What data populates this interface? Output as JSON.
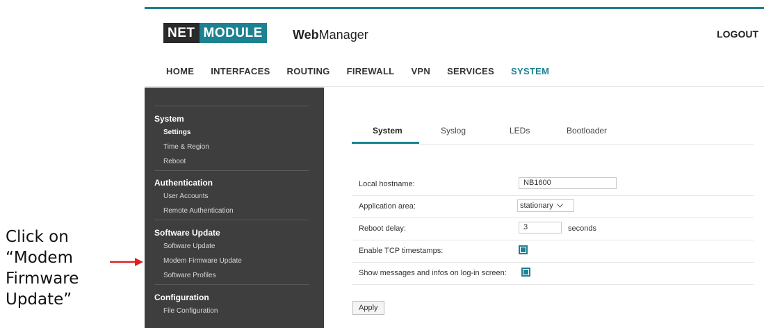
{
  "annotation": {
    "lines": [
      "Click on",
      "“Modem",
      "Firmware",
      "Update”"
    ],
    "arrow_color": "#e02020"
  },
  "header": {
    "logo_net": "NET",
    "logo_module": "MODULE",
    "app_bold": "Web",
    "app_rest": "Manager",
    "logout": "LOGOUT"
  },
  "nav": [
    "HOME",
    "INTERFACES",
    "ROUTING",
    "FIREWALL",
    "VPN",
    "SERVICES",
    "SYSTEM"
  ],
  "nav_active": "SYSTEM",
  "sidebar": {
    "system": {
      "title": "System",
      "items": [
        "Settings",
        "Time & Region",
        "Reboot"
      ]
    },
    "auth": {
      "title": "Authentication",
      "items": [
        "User Accounts",
        "Remote Authentication"
      ]
    },
    "sw": {
      "title": "Software Update",
      "items": [
        "Software Update",
        "Modem Firmware Update",
        "Software Profiles"
      ]
    },
    "config": {
      "title": "Configuration",
      "items": [
        "File Configuration"
      ]
    }
  },
  "tabs": [
    "System",
    "Syslog",
    "LEDs",
    "Bootloader"
  ],
  "form": {
    "hostname_label": "Local hostname:",
    "hostname_value": "NB1600",
    "area_label": "Application area:",
    "area_value": "stationary",
    "reboot_label": "Reboot delay:",
    "reboot_value": "3",
    "reboot_unit": "seconds",
    "tcp_label": "Enable TCP timestamps:",
    "tcp_checked": true,
    "msg_label": "Show messages and infos on log-in screen:",
    "msg_checked": true
  },
  "apply_label": "Apply",
  "colors": {
    "accent": "#1c8291",
    "sidebar_bg": "#3e3e3e",
    "logo_dark": "#2a2a2a"
  }
}
